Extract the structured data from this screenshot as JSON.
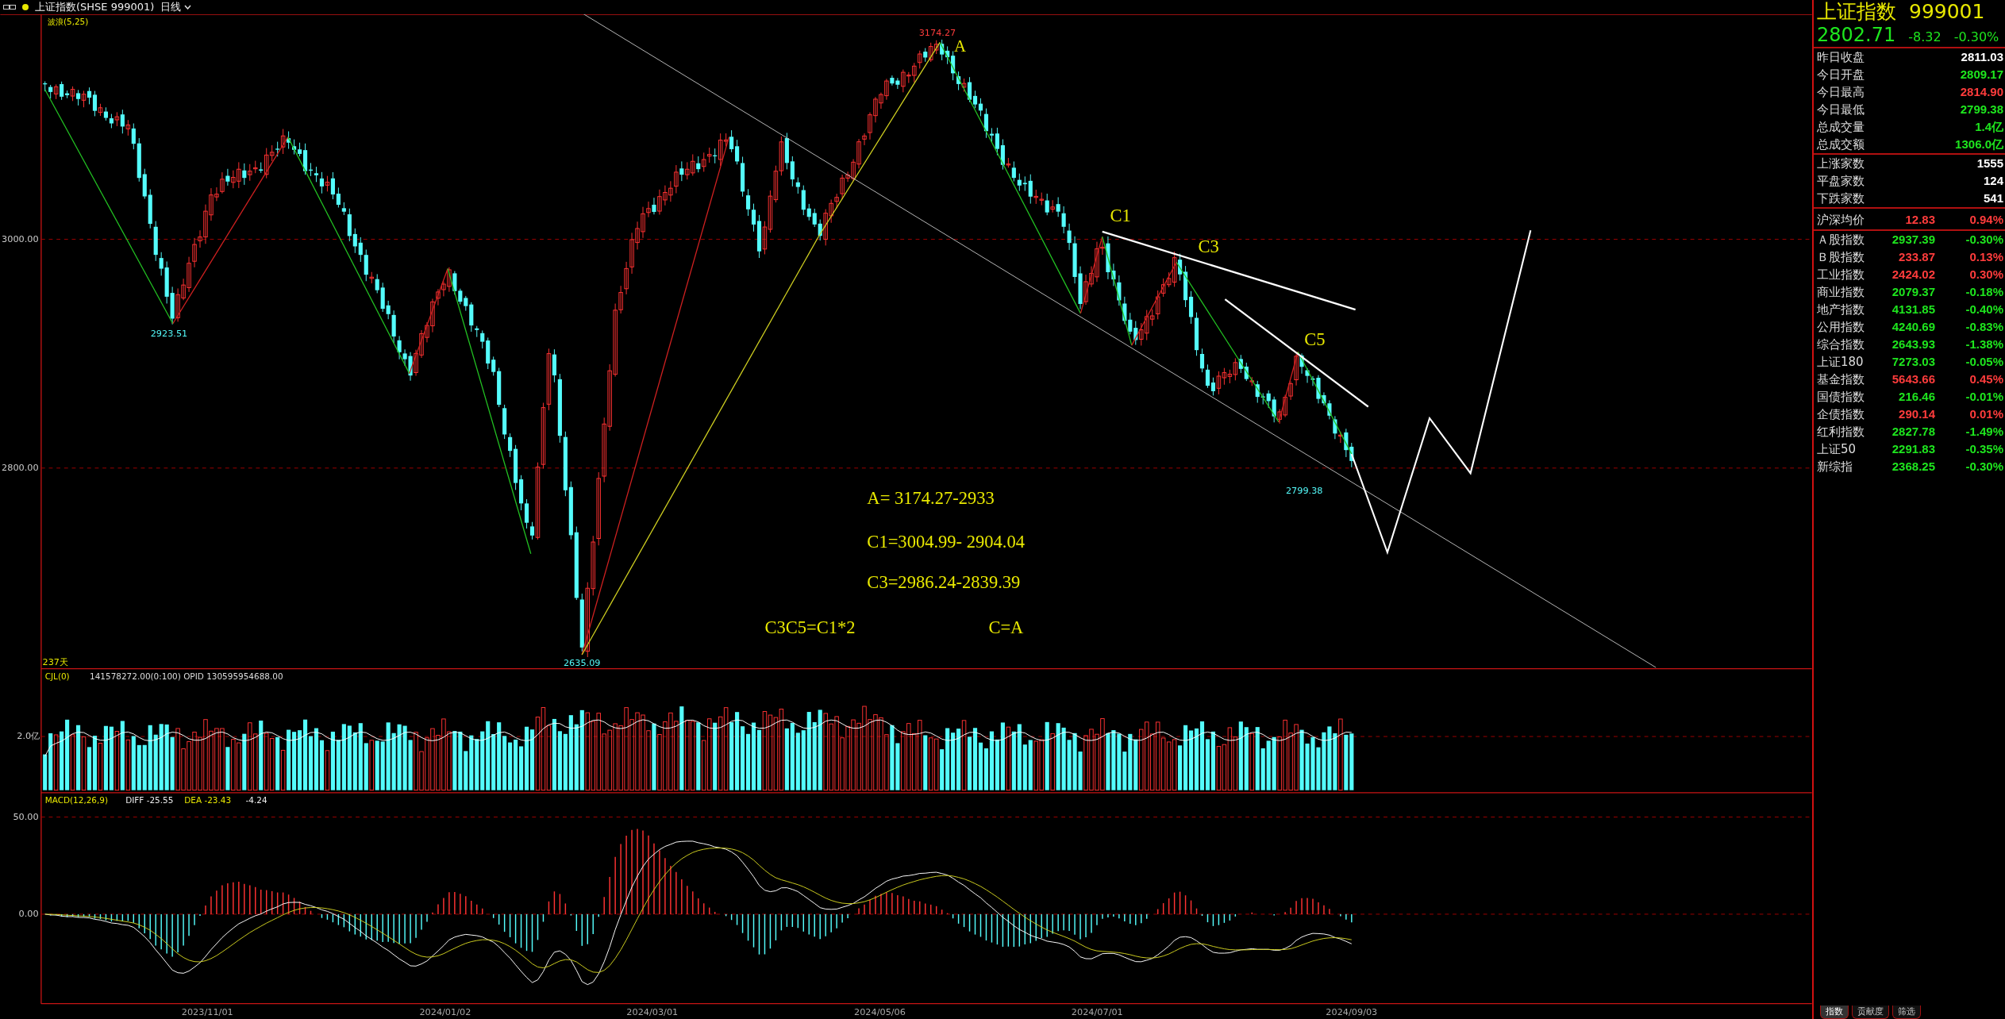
{
  "header": {
    "title": "上证指数(SHSE 999001)",
    "period": "日线"
  },
  "price_panel": {
    "indicator": "波浪(5,25)",
    "y_labels": [
      "3000.00",
      "2800.00"
    ],
    "price_labels": [
      {
        "text": "3174.27",
        "kind": "high"
      },
      {
        "text": "2923.51",
        "kind": "low"
      },
      {
        "text": "2635.09",
        "kind": "low"
      },
      {
        "text": "2799.38",
        "kind": "low"
      }
    ],
    "wave_labels": [
      "A",
      "C1",
      "C3",
      "C5"
    ],
    "annotations": [
      "A= 3174.27-2933",
      "C1=3004.99- 2904.04",
      "C3=2986.24-2839.39",
      "C3C5=C1*2",
      "C=A"
    ],
    "bar_count": "237天"
  },
  "volume_panel": {
    "indicator": "CJL(0)",
    "reading": "141578272.00(0:100)  OPID 130595954688.00",
    "y_label": "2.0亿"
  },
  "macd_panel": {
    "indicator": "MACD(12,26,9)",
    "diff": "DIFF -25.55",
    "dea": "DEA -23.43",
    "macd": "-4.24",
    "y_labels": [
      "50.00",
      "0.00"
    ]
  },
  "date_axis": [
    "2023/11/01",
    "2024/01/02",
    "2024/03/01",
    "2024/05/06",
    "2024/07/01",
    "2024/09/03"
  ],
  "quote": {
    "name": "上证指数",
    "code": "999001",
    "price": "2802.71",
    "change": "-8.32",
    "change_pct": "-0.30%",
    "color": "#1ee61e"
  },
  "stats": [
    {
      "label": "昨日收盘",
      "value": "2811.03",
      "color": "#ffffff"
    },
    {
      "label": "今日开盘",
      "value": "2809.17",
      "color": "#1ee61e"
    },
    {
      "label": "今日最高",
      "value": "2814.90",
      "color": "#ff3c3c"
    },
    {
      "label": "今日最低",
      "value": "2799.38",
      "color": "#1ee61e"
    },
    {
      "label": "总成交量",
      "value": "1.4亿",
      "color": "#1ee61e"
    },
    {
      "label": "总成交额",
      "value": "1306.0亿",
      "color": "#1ee61e"
    }
  ],
  "breadth": [
    {
      "label": "上涨家数",
      "value": "1555"
    },
    {
      "label": "平盘家数",
      "value": "124"
    },
    {
      "label": "下跌家数",
      "value": "541"
    }
  ],
  "average": {
    "label": "沪深均价",
    "value": "12.83",
    "change": "0.94%",
    "color": "#ff3c3c"
  },
  "indices": [
    {
      "label": "Ａ股指数",
      "value": "2937.39",
      "change": "-0.30%",
      "color": "#1ee61e"
    },
    {
      "label": "Ｂ股指数",
      "value": "233.87",
      "change": "0.13%",
      "color": "#ff3c3c"
    },
    {
      "label": "工业指数",
      "value": "2424.02",
      "change": "0.30%",
      "color": "#ff3c3c"
    },
    {
      "label": "商业指数",
      "value": "2079.37",
      "change": "-0.18%",
      "color": "#1ee61e"
    },
    {
      "label": "地产指数",
      "value": "4131.85",
      "change": "-0.40%",
      "color": "#1ee61e"
    },
    {
      "label": "公用指数",
      "value": "4240.69",
      "change": "-0.83%",
      "color": "#1ee61e"
    },
    {
      "label": "综合指数",
      "value": "2643.93",
      "change": "-1.38%",
      "color": "#1ee61e"
    },
    {
      "label": "上证180",
      "value": "7273.03",
      "change": "-0.05%",
      "color": "#1ee61e"
    },
    {
      "label": "基金指数",
      "value": "5643.66",
      "change": "0.45%",
      "color": "#ff3c3c"
    },
    {
      "label": "国债指数",
      "value": "216.46",
      "change": "-0.01%",
      "color": "#1ee61e"
    },
    {
      "label": "企债指数",
      "value": "290.14",
      "change": "0.01%",
      "color": "#ff3c3c"
    },
    {
      "label": "红利指数",
      "value": "2827.78",
      "change": "-1.49%",
      "color": "#1ee61e"
    },
    {
      "label": "上证50",
      "value": "2291.83",
      "change": "-0.35%",
      "color": "#1ee61e"
    },
    {
      "label": "新综指",
      "value": "2368.25",
      "change": "-0.30%",
      "color": "#1ee61e"
    }
  ],
  "bottom_tabs": [
    {
      "label": "指数",
      "selected": true
    },
    {
      "label": "贡献度",
      "selected": false
    },
    {
      "label": "筛选",
      "selected": false
    }
  ]
}
